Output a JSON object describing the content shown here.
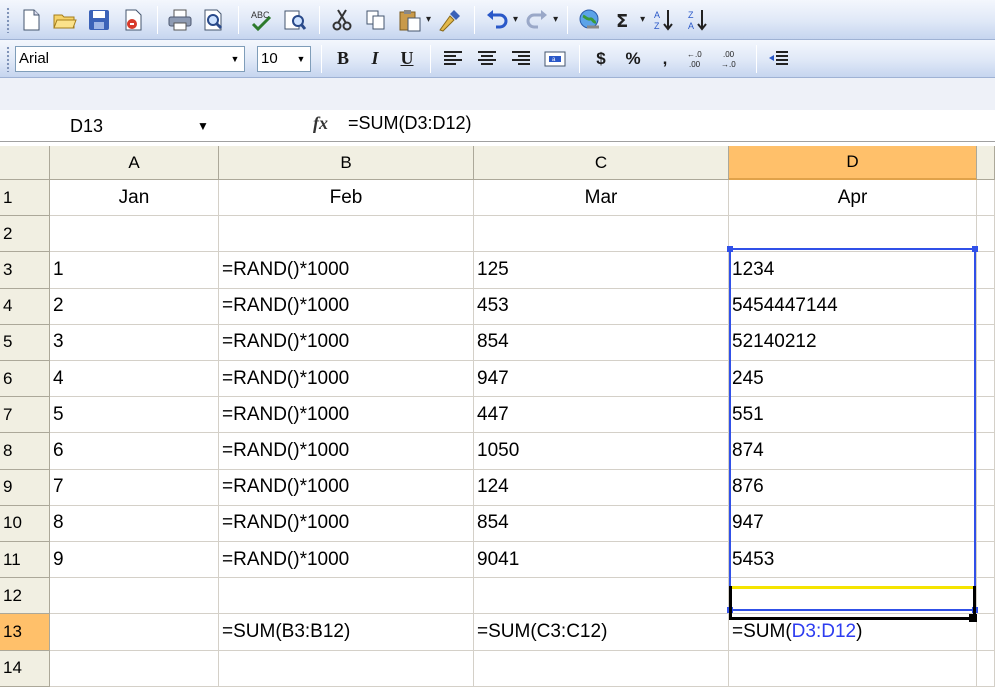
{
  "toolbar_standard": {
    "icons": [
      "new-icon",
      "open-icon",
      "save-icon",
      "permission-icon",
      "print-icon",
      "print-preview-icon",
      "spelling-icon",
      "research-icon",
      "cut-icon",
      "copy-icon",
      "paste-icon",
      "format-painter-icon",
      "undo-icon",
      "redo-icon",
      "insert-hyperlink-icon",
      "autosum-icon",
      "sort-ascending-icon",
      "sort-descending-icon"
    ]
  },
  "toolbar_formatting": {
    "font": "Arial",
    "size": "10",
    "bold": "B",
    "italic": "I",
    "underline": "U",
    "currency": "$",
    "percent": "%",
    "comma": ","
  },
  "formula_bar": {
    "name_box": "D13",
    "fx": "fx",
    "formula": "=SUM(D3:D12)"
  },
  "sheet": {
    "columns": [
      "A",
      "B",
      "C",
      "D"
    ],
    "rows": [
      "1",
      "2",
      "3",
      "4",
      "5",
      "6",
      "7",
      "8",
      "9",
      "10",
      "11",
      "12",
      "13",
      "14"
    ],
    "cells": {
      "r1": [
        "Jan",
        "Feb",
        "Mar",
        "Apr"
      ],
      "r3": [
        "1",
        "=RAND()*1000",
        "125",
        "1234"
      ],
      "r4": [
        "2",
        "=RAND()*1000",
        "453",
        "5454447144"
      ],
      "r5": [
        "3",
        "=RAND()*1000",
        "854",
        "52140212"
      ],
      "r6": [
        "4",
        "=RAND()*1000",
        "947",
        "245"
      ],
      "r7": [
        "5",
        "=RAND()*1000",
        "447",
        "551"
      ],
      "r8": [
        "6",
        "=RAND()*1000",
        "1050",
        "874"
      ],
      "r9": [
        "7",
        "=RAND()*1000",
        "124",
        "876"
      ],
      "r10": [
        "8",
        "=RAND()*1000",
        "854",
        "947"
      ],
      "r11": [
        "9",
        "=RAND()*1000",
        "9041",
        "5453"
      ],
      "r13": [
        "",
        "=SUM(B3:B12)",
        "=SUM(C3:C12)"
      ],
      "d13_prefix": "=SUM(",
      "d13_ref": "D3:D12",
      "d13_suffix": ")"
    },
    "active_cell": "D13",
    "selected_range": "D3:D12",
    "highlight_color": "#ffc06a",
    "range_color": "#3050e8"
  }
}
